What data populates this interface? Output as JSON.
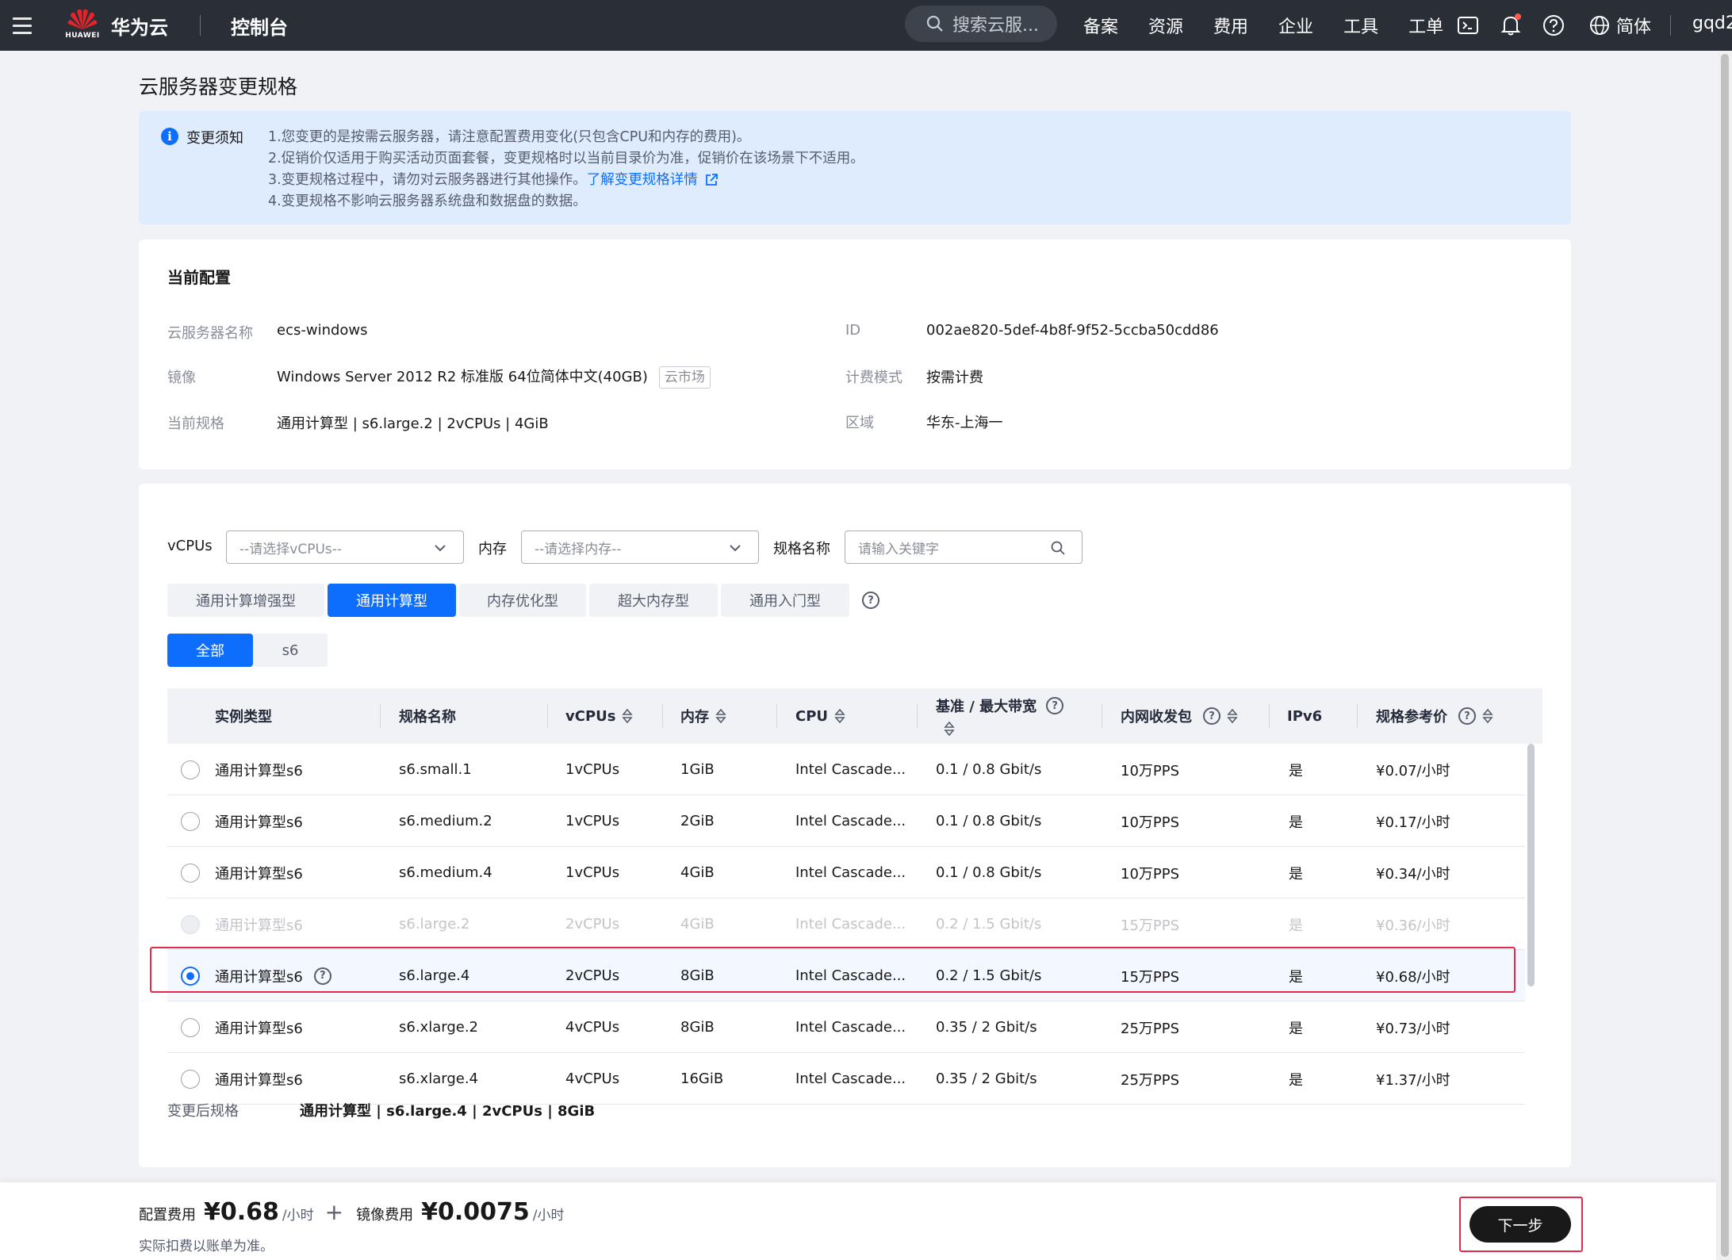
{
  "topnav": {
    "logo_word": "HUAWEI",
    "brand": "华为云",
    "console": "控制台",
    "search_placeholder": "搜索云服...",
    "links": [
      "备案",
      "资源",
      "费用",
      "企业",
      "工具",
      "工单"
    ],
    "icons": [
      "terminal-icon",
      "bell-icon",
      "help-icon"
    ],
    "language": "简体",
    "user": "gqd2"
  },
  "page": {
    "title": "云服务器变更规格"
  },
  "notice": {
    "label": "变更须知",
    "lines": [
      "1.您变更的是按需云服务器，请注意配置费用变化(只包含CPU和内存的费用)。",
      "2.促销价仅适用于购买活动页面套餐，变更规格时以当前目录价为准，促销价在该场景下不适用。",
      "3.变更规格过程中，请勿对云服务器进行其他操作。"
    ],
    "link_text": "了解变更规格详情",
    "line4": "4.变更规格不影响云服务器系统盘和数据盘的数据。"
  },
  "current": {
    "title": "当前配置",
    "name_label": "云服务器名称",
    "name_value": "ecs-windows",
    "id_label": "ID",
    "id_value": "002ae820-5def-4b8f-9f52-5ccba50cdd86",
    "image_label": "镜像",
    "image_value": "Windows Server 2012 R2 标准版 64位简体中文(40GB)",
    "image_tag": "云市场",
    "billing_label": "计费模式",
    "billing_value": "按需计费",
    "spec_label": "当前规格",
    "spec_value": "通用计算型 | s6.large.2 | 2vCPUs | 4GiB",
    "region_label": "区域",
    "region_value": "华东-上海一"
  },
  "filters": {
    "vcpu_label": "vCPUs",
    "vcpu_placeholder": "--请选择vCPUs--",
    "mem_label": "内存",
    "mem_placeholder": "--请选择内存--",
    "name_label": "规格名称",
    "name_placeholder": "请输入关键字"
  },
  "tabs": [
    {
      "label": "通用计算增强型",
      "active": false
    },
    {
      "label": "通用计算型",
      "active": true
    },
    {
      "label": "内存优化型",
      "active": false
    },
    {
      "label": "超大内存型",
      "active": false
    },
    {
      "label": "通用入门型",
      "active": false
    }
  ],
  "chips": [
    {
      "label": "全部",
      "active": true
    },
    {
      "label": "s6",
      "active": false
    }
  ],
  "table": {
    "headers": {
      "type": "实例类型",
      "name": "规格名称",
      "vcpus": "vCPUs",
      "memory": "内存",
      "cpu": "CPU",
      "bandwidth_line1": "基准 / 最大带宽",
      "pps": "内网收发包",
      "ipv6": "IPv6",
      "price": "规格参考价"
    },
    "rows": [
      {
        "type": "通用计算型s6",
        "name": "s6.small.1",
        "vcpus": "1vCPUs",
        "memory": "1GiB",
        "cpu": "Intel Cascade...",
        "bandwidth": "0.1 / 0.8 Gbit/s",
        "pps": "10万PPS",
        "ipv6": "是",
        "price": "¥0.07/小时",
        "state": "normal"
      },
      {
        "type": "通用计算型s6",
        "name": "s6.medium.2",
        "vcpus": "1vCPUs",
        "memory": "2GiB",
        "cpu": "Intel Cascade...",
        "bandwidth": "0.1 / 0.8 Gbit/s",
        "pps": "10万PPS",
        "ipv6": "是",
        "price": "¥0.17/小时",
        "state": "normal"
      },
      {
        "type": "通用计算型s6",
        "name": "s6.medium.4",
        "vcpus": "1vCPUs",
        "memory": "4GiB",
        "cpu": "Intel Cascade...",
        "bandwidth": "0.1 / 0.8 Gbit/s",
        "pps": "10万PPS",
        "ipv6": "是",
        "price": "¥0.34/小时",
        "state": "normal"
      },
      {
        "type": "通用计算型s6",
        "name": "s6.large.2",
        "vcpus": "2vCPUs",
        "memory": "4GiB",
        "cpu": "Intel Cascade...",
        "bandwidth": "0.2 / 1.5 Gbit/s",
        "pps": "15万PPS",
        "ipv6": "是",
        "price": "¥0.36/小时",
        "state": "disabled"
      },
      {
        "type": "通用计算型s6",
        "name": "s6.large.4",
        "vcpus": "2vCPUs",
        "memory": "8GiB",
        "cpu": "Intel Cascade...",
        "bandwidth": "0.2 / 1.5 Gbit/s",
        "pps": "15万PPS",
        "ipv6": "是",
        "price": "¥0.68/小时",
        "state": "selected"
      },
      {
        "type": "通用计算型s6",
        "name": "s6.xlarge.2",
        "vcpus": "4vCPUs",
        "memory": "8GiB",
        "cpu": "Intel Cascade...",
        "bandwidth": "0.35 / 2 Gbit/s",
        "pps": "25万PPS",
        "ipv6": "是",
        "price": "¥0.73/小时",
        "state": "normal"
      },
      {
        "type": "通用计算型s6",
        "name": "s6.xlarge.4",
        "vcpus": "4vCPUs",
        "memory": "16GiB",
        "cpu": "Intel Cascade...",
        "bandwidth": "0.35 / 2 Gbit/s",
        "pps": "25万PPS",
        "ipv6": "是",
        "price": "¥1.37/小时",
        "state": "normal"
      }
    ]
  },
  "after": {
    "label": "变更后规格",
    "value": "通用计算型 | s6.large.4 | 2vCPUs | 8GiB"
  },
  "footer": {
    "config_fee_label": "配置费用",
    "config_fee": "¥0.68",
    "config_unit": "/小时",
    "plus": "+",
    "image_fee_label": "镜像费用",
    "image_fee": "¥0.0075",
    "image_unit": "/小时",
    "note": "实际扣费以账单为准。",
    "next_label": "下一步"
  }
}
